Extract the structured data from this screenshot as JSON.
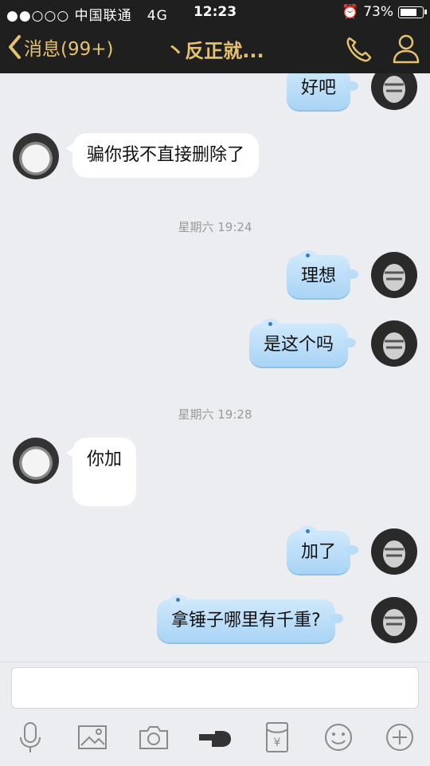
{
  "status_bar": {
    "carrier": "●●○○○ 中国联通",
    "network": "4G",
    "time": "12:23",
    "battery": "73%"
  },
  "nav": {
    "back_label": "消息(99+)",
    "title": "丶反正就..."
  },
  "messages": [
    {
      "side": "out",
      "text": "好吧"
    },
    {
      "side": "in",
      "text": "骗你我不直接删除了"
    },
    {
      "type": "timestamp",
      "text": "星期六 19:24"
    },
    {
      "side": "out",
      "text": "理想"
    },
    {
      "side": "out",
      "text": "是这个吗"
    },
    {
      "type": "timestamp",
      "text": "星期六 19:28"
    },
    {
      "side": "in",
      "text": "你加"
    },
    {
      "side": "out",
      "text": "加了"
    },
    {
      "side": "out",
      "text": "拿锤子哪里有千重?"
    }
  ],
  "input": {
    "placeholder": ""
  },
  "toolbar": [
    "microphone-icon",
    "image-icon",
    "camera-icon",
    "poke-hand-icon",
    "red-envelope-icon",
    "emoji-icon",
    "plus-icon"
  ],
  "colors": {
    "nav_bg": "#1f1f1f",
    "accent": "#e5c26f",
    "bubble_out": "#b9ddf8",
    "bubble_in": "#ffffff",
    "chat_bg": "#ecedf1"
  }
}
